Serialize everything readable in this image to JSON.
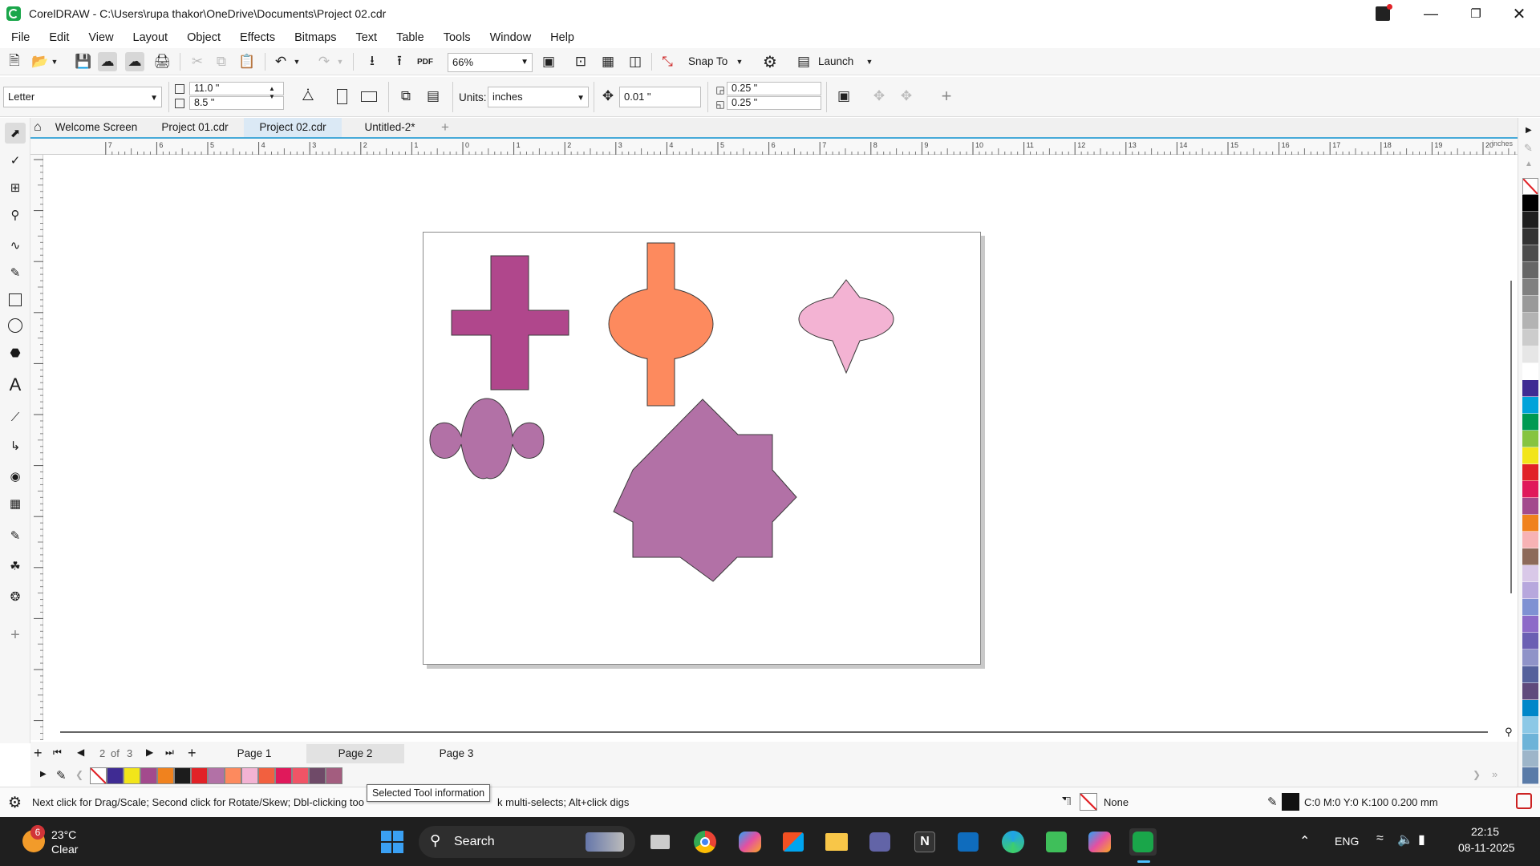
{
  "window": {
    "title": "CorelDRAW - C:\\Users\\rupa thakor\\OneDrive\\Documents\\Project 02.cdr"
  },
  "menu": [
    "File",
    "Edit",
    "View",
    "Layout",
    "Object",
    "Effects",
    "Bitmaps",
    "Text",
    "Table",
    "Tools",
    "Window",
    "Help"
  ],
  "toolbar": {
    "zoom": "66%",
    "snap_to": "Snap To",
    "launch": "Launch"
  },
  "property_bar": {
    "paper_size": "Letter",
    "width": "11.0 \"",
    "height": "8.5 \"",
    "units_label": "Units:",
    "units": "inches",
    "nudge": "0.01 \"",
    "dup_x": "0.25 \"",
    "dup_y": "0.25 \""
  },
  "tabs": [
    "Welcome Screen",
    "Project 01.cdr",
    "Project 02.cdr",
    "Untitled-2*"
  ],
  "ruler": {
    "top_ticks": [
      "7",
      "6",
      "5",
      "4",
      "3",
      "2",
      "1",
      "0",
      "1",
      "2",
      "3",
      "4",
      "5",
      "6",
      "7",
      "8",
      "9",
      "10",
      "11",
      "12",
      "13",
      "14",
      "15",
      "16",
      "17",
      "18",
      "19",
      "20"
    ],
    "unit": "inches"
  },
  "page_nav": {
    "current": "2",
    "of_label": "of",
    "total": "3",
    "pages": [
      "Page 1",
      "Page 2",
      "Page 3"
    ]
  },
  "status": {
    "message": "Next click for Drag/Scale; Second click for Rotate/Skew; Dbl-clicking too",
    "message_tail": "k multi-selects; Alt+click digs",
    "tooltip": "Selected Tool information",
    "fill": "None",
    "outline": "C:0 M:0 Y:0 K:100  0.200 mm"
  },
  "taskbar": {
    "weather_temp": "23°C",
    "weather_desc": "Clear",
    "weather_badge": "6",
    "search": "Search",
    "lang": "ENG",
    "time": "22:15",
    "date": "08-11-2025"
  },
  "colors": {
    "cross": "#b0478c",
    "ellipse_orange": "#fd8a5e",
    "lens_pink": "#f3b3d3",
    "mauve": "#b271a6",
    "accent": "#46a9d8"
  },
  "doc_palette": [
    "none",
    "#3f2b93",
    "#f2e51a",
    "#a34a8d",
    "#f0821e",
    "#1c1c1c",
    "#e12227",
    "#b271a6",
    "#fd8a5e",
    "#f3b3d3",
    "#f2603f",
    "#e0195b",
    "#f05466",
    "#6f4a68",
    "#a35d7f"
  ],
  "color_palette": [
    "none",
    "#000000",
    "#1f1f1f",
    "#333333",
    "#4d4d4d",
    "#666666",
    "#808080",
    "#999999",
    "#b3b3b3",
    "#cccccc",
    "#e6e6e6",
    "#ffffff",
    "#3f2b93",
    "#00a3da",
    "#009a52",
    "#86c440",
    "#f2e51a",
    "#e12227",
    "#e0195b",
    "#a34a8d",
    "#f0821e",
    "#f7b2b4",
    "#8d6a5a",
    "#d9c8e8",
    "#b7a7dd",
    "#7f91d3",
    "#8d6ac8",
    "#6b5fb3",
    "#8f93c8",
    "#55619c",
    "#5f4a7c",
    "#0087c9",
    "#8cc8e6",
    "#6db3d8",
    "#9db5c9",
    "#5a7ba8"
  ]
}
